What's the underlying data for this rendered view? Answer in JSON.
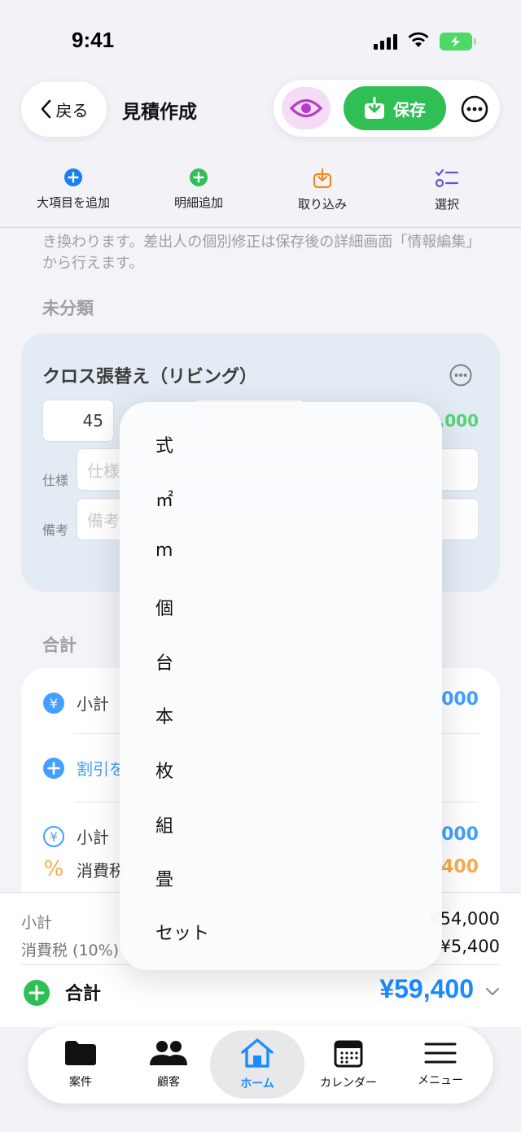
{
  "status": {
    "time": "9:41"
  },
  "header": {
    "back_label": "戻る",
    "title": "見積作成",
    "save_label": "保存"
  },
  "toolbar": {
    "items": [
      {
        "label": "大項目を追加",
        "icon": "plus-circle-blue",
        "color": "#1a7ff0"
      },
      {
        "label": "明細追加",
        "icon": "plus-circle-green",
        "color": "#2fbf55"
      },
      {
        "label": "取り込み",
        "icon": "import-icon",
        "color": "#f08a24"
      },
      {
        "label": "選択",
        "icon": "checklist-icon",
        "color": "#5b5bd6"
      }
    ]
  },
  "content": {
    "notice": "き換わります。差出人の個別修正は保存後の詳細画面「情報編集」から行えます。",
    "section_uncategorized": "未分類",
    "item": {
      "title": "クロス張替え（リビング）",
      "quantity": "45",
      "amount_suffix": ",000",
      "spec_label": "仕様",
      "spec_placeholder": "仕様",
      "note_label": "備考",
      "note_placeholder": "備考"
    },
    "section_total": "合計",
    "totals": {
      "subtotal_label": "小計",
      "subtotal_value": "000",
      "discount_label": "割引を",
      "subtotal2_label": "小計",
      "subtotal2_value": "000",
      "tax_label": "消費税",
      "tax_value": "400"
    }
  },
  "summary": {
    "subtotal_label": "小計",
    "subtotal_value": "¥54,000",
    "tax_label": "消費税 (10%)",
    "tax_value": "¥5,400",
    "total_label": "合計",
    "total_value": "¥59,400"
  },
  "tabs": [
    {
      "label": "案件",
      "icon": "folder-icon"
    },
    {
      "label": "顧客",
      "icon": "people-icon"
    },
    {
      "label": "ホーム",
      "icon": "home-icon",
      "active": true
    },
    {
      "label": "カレンダー",
      "icon": "calendar-icon"
    },
    {
      "label": "メニュー",
      "icon": "menu-icon"
    }
  ],
  "unit_dropdown": {
    "options": [
      "式",
      "㎡",
      "m",
      "個",
      "台",
      "本",
      "枚",
      "組",
      "畳",
      "セット"
    ]
  },
  "colors": {
    "accent_blue": "#1a8cff",
    "save_green": "#2fbf55",
    "eye_purple": "#b43cc9",
    "tax_orange": "#f39a2b"
  }
}
